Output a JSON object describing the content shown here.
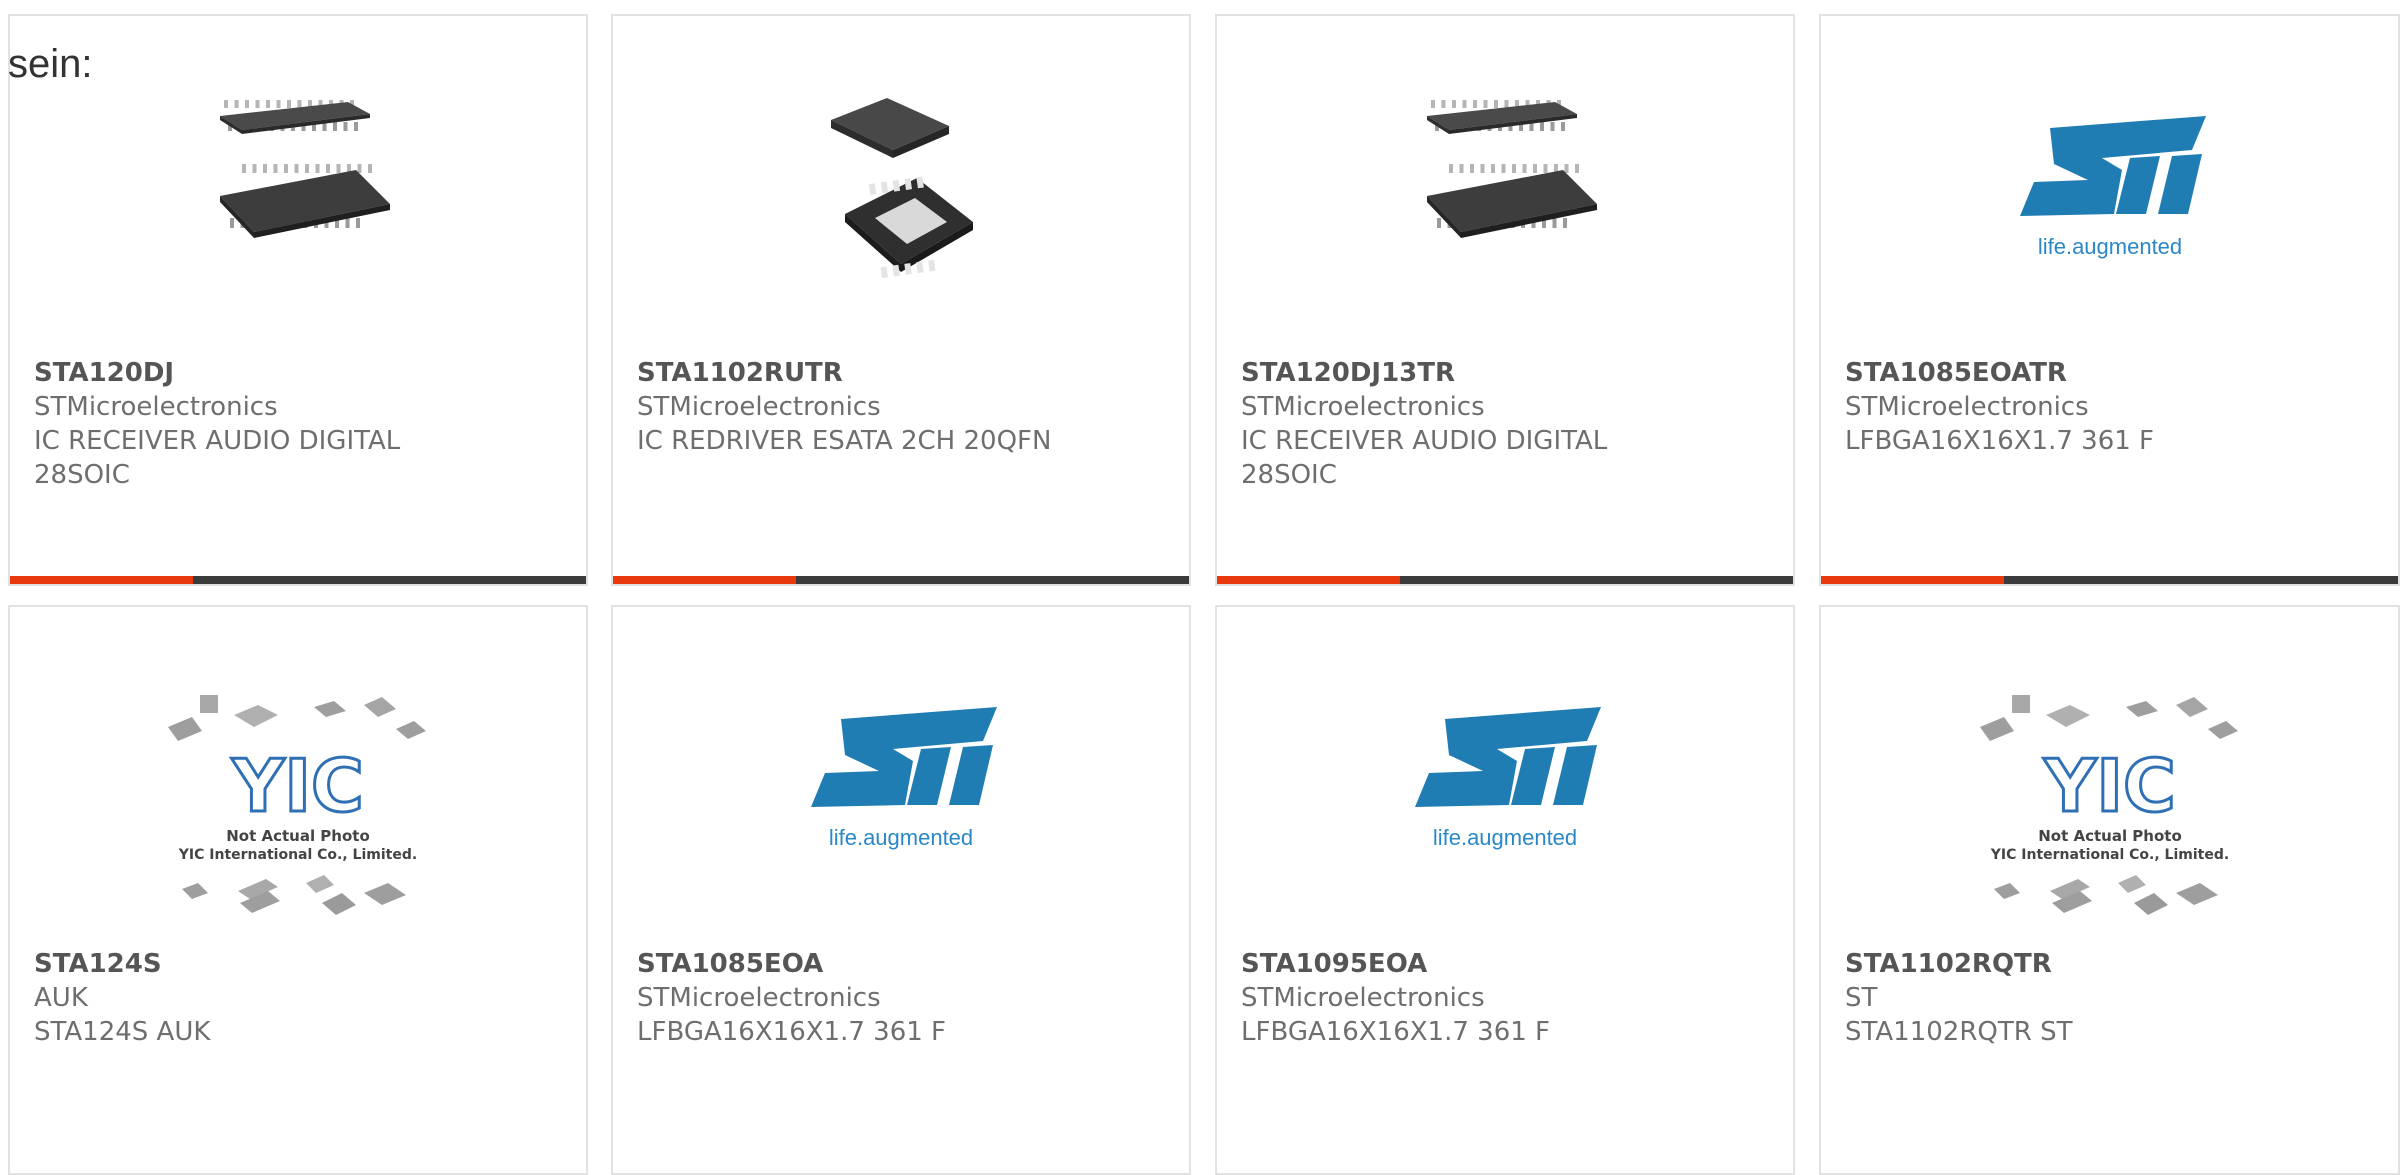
{
  "intro_text": "sein:",
  "colors": {
    "accent": "#e8380d",
    "bar": "#3b3b3b",
    "st_blue": "#1f7db3"
  },
  "products": [
    {
      "part_number": "STA120DJ",
      "manufacturer": "STMicroelectronics",
      "description": "IC RECEIVER AUDIO DIGITAL 28SOIC",
      "image": "soic-chip-photo"
    },
    {
      "part_number": "STA1102RUTR",
      "manufacturer": "STMicroelectronics",
      "description": "IC REDRIVER ESATA 2CH 20QFN",
      "image": "qfn-chip-photo"
    },
    {
      "part_number": "STA120DJ13TR",
      "manufacturer": "STMicroelectronics",
      "description": "IC RECEIVER AUDIO DIGITAL 28SOIC",
      "image": "soic-chip-photo"
    },
    {
      "part_number": "STA1085EOATR",
      "manufacturer": "STMicroelectronics",
      "description": "LFBGA16X16X1.7 361 F",
      "image": "st-logo"
    },
    {
      "part_number": "STA124S",
      "manufacturer": "AUK",
      "description": "STA124S AUK",
      "image": "yic-placeholder"
    },
    {
      "part_number": "STA1085EOA",
      "manufacturer": "STMicroelectronics",
      "description": "LFBGA16X16X1.7 361 F",
      "image": "st-logo"
    },
    {
      "part_number": "STA1095EOA",
      "manufacturer": "STMicroelectronics",
      "description": "LFBGA16X16X1.7 361 F",
      "image": "st-logo"
    },
    {
      "part_number": "STA1102RQTR",
      "manufacturer": "ST",
      "description": "STA1102RQTR ST",
      "image": "yic-placeholder"
    }
  ],
  "logos": {
    "st_tagline": "life.augmented",
    "yic_mark": "YIC",
    "yic_line1": "Not Actual Photo",
    "yic_line2": "YIC International Co., Limited."
  }
}
